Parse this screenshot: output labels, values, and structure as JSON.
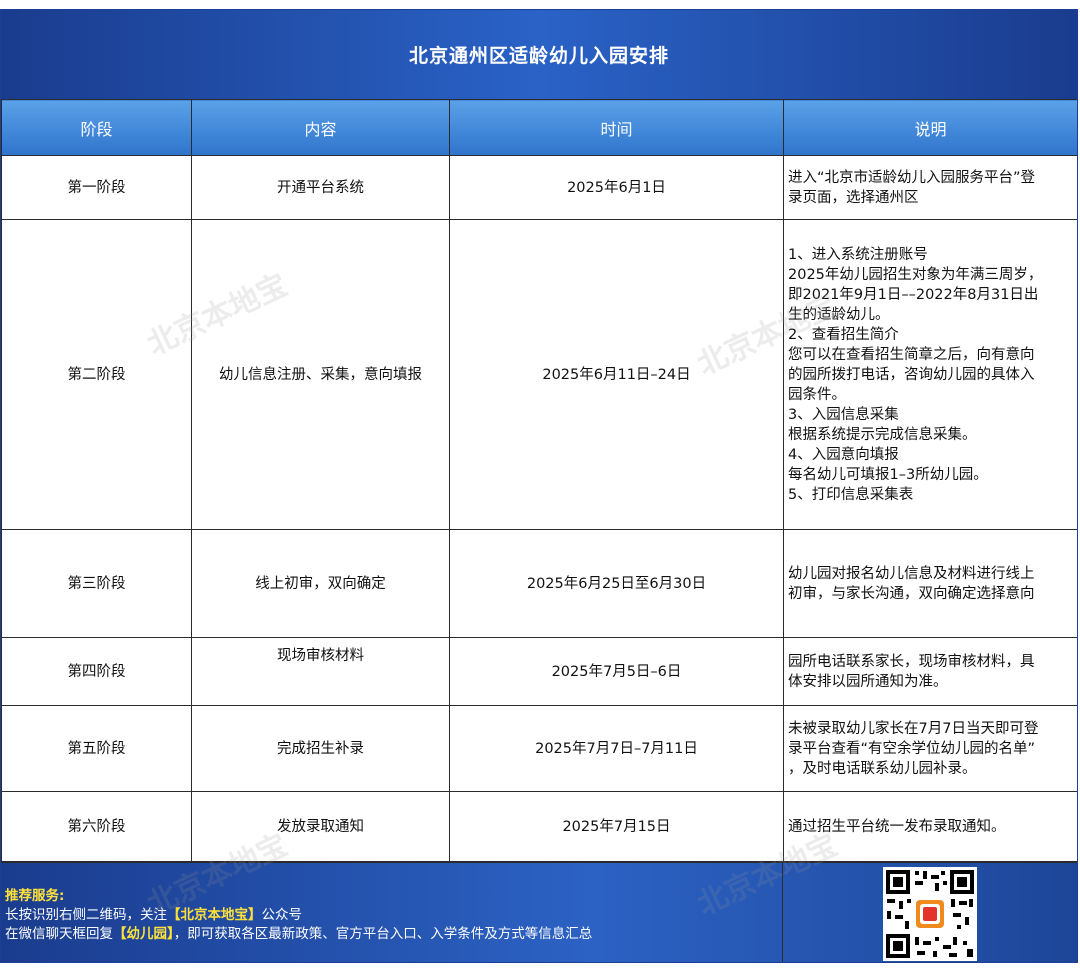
{
  "title": "北京通州区适龄幼儿入园安排",
  "headers": [
    "阶段",
    "内容",
    "时间",
    "说明"
  ],
  "rows": [
    {
      "stage": "第一阶段",
      "content": "开通平台系统",
      "time": "2025年6月1日",
      "desc": [
        "进入“北京市适龄幼儿入园服务平台”登",
        "录页面，选择通州区"
      ]
    },
    {
      "stage": "第二阶段",
      "content": "幼儿信息注册、采集，意向填报",
      "time": "2025年6月11日–24日",
      "desc": [
        "1、进入系统注册账号",
        "2025年幼儿园招生对象为年满三周岁，",
        "即2021年9月1日––2022年8月31日出",
        "生的适龄幼儿。",
        "2、查看招生简介",
        "您可以在查看招生简章之后，向有意向",
        "的园所拨打电话，咨询幼儿园的具体入",
        "园条件。",
        "3、入园信息采集",
        "根据系统提示完成信息采集。",
        "4、入园意向填报",
        "每名幼儿可填报1–3所幼儿园。",
        "5、打印信息采集表"
      ]
    },
    {
      "stage": "第三阶段",
      "content": "线上初审，双向确定",
      "time": "2025年6月25日至6月30日",
      "desc": [
        "幼儿园对报名幼儿信息及材料进行线上",
        "初审，与家长沟通，双向确定选择意向"
      ]
    },
    {
      "stage": "第四阶段",
      "content": "现场审核材料",
      "time": "2025年7月5日–6日",
      "desc": [
        "园所电话联系家长，现场审核材料，具",
        "体安排以园所通知为准。"
      ]
    },
    {
      "stage": "第五阶段",
      "content": "完成招生补录",
      "time": "2025年7月7日–7月11日",
      "desc": [
        "未被录取幼儿家长在7月7日当天即可登",
        "录平台查看“有空余学位幼儿园的名单”",
        "，及时电话联系幼儿园补录。"
      ]
    },
    {
      "stage": "第六阶段",
      "content": "发放录取通知",
      "time": "2025年7月15日",
      "desc": [
        "通过招生平台统一发布录取通知。"
      ]
    }
  ],
  "footer": {
    "title": "推荐服务:",
    "line1_pre": "长按识别右侧二维码，关注",
    "line1_hl": "【北京本地宝】",
    "line1_post": "公众号",
    "line2_pre": "在微信聊天框回复",
    "line2_hl": "【幼儿园】",
    "line2_post": "，即可获取各区最新政策、官方平台入口、入学条件及方式等信息汇总"
  },
  "watermark": "北京本地宝",
  "colors": {
    "header_dark": "#1a3c8e",
    "header_light": "#5aa1e8",
    "highlight": "#ffe03a"
  }
}
